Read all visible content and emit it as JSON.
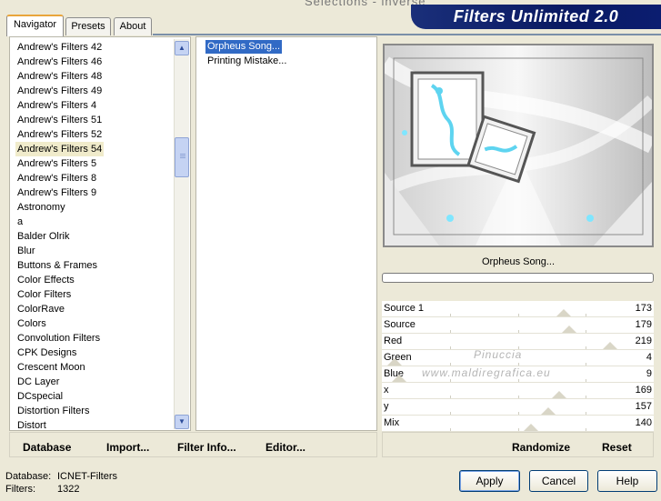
{
  "app": {
    "brand_title": "Filters Unlimited 2.0",
    "faint_title": "Selections - inverse"
  },
  "tabs": [
    {
      "label": "Navigator",
      "active": true
    },
    {
      "label": "Presets",
      "active": false
    },
    {
      "label": "About",
      "active": false
    }
  ],
  "categories": {
    "selected": "Andrew's Filters 54",
    "items": [
      "Andrew's Filters 42",
      "Andrew's Filters 46",
      "Andrew's Filters 48",
      "Andrew's Filters 49",
      "Andrew's Filters 4",
      "Andrew's Filters 51",
      "Andrew's Filters 52",
      "Andrew's Filters 54",
      "Andrew's Filters 5",
      "Andrew's Filters 8",
      "Andrew's Filters 9",
      "Astronomy",
      "a",
      "Balder Olrik",
      "Blur",
      "Buttons & Frames",
      "Color Effects",
      "Color Filters",
      "ColorRave",
      "Colors",
      "Convolution Filters",
      "CPK Designs",
      "Crescent Moon",
      "DC Layer",
      "DCspecial",
      "Distortion Filters",
      "Distort"
    ]
  },
  "filters": {
    "selected": "Orpheus Song...",
    "items": [
      "Orpheus Song...",
      "Printing Mistake..."
    ]
  },
  "preview": {
    "filter_name": "Orpheus Song...",
    "watermark_line1": "Pinuccia",
    "watermark_line2": "www.maldiregrafica.eu"
  },
  "params": [
    {
      "label": "Source 1",
      "value": "173",
      "level": 0.68
    },
    {
      "label": "Source",
      "value": "179",
      "level": 0.7
    },
    {
      "label": "Red",
      "value": "219",
      "level": 0.86
    },
    {
      "label": "Green",
      "value": "4",
      "level": 0.02
    },
    {
      "label": "Blue",
      "value": "9",
      "level": 0.04
    },
    {
      "label": "x",
      "value": "169",
      "level": 0.66
    },
    {
      "label": "y",
      "value": "157",
      "level": 0.62
    },
    {
      "label": "Mix",
      "value": "140",
      "level": 0.55
    }
  ],
  "left_buttons": {
    "database": "Database",
    "import": "Import...",
    "filter_info": "Filter Info...",
    "editor": "Editor..."
  },
  "right_buttons": {
    "randomize": "Randomize",
    "reset": "Reset"
  },
  "status": {
    "database_label": "Database:",
    "database_value": "ICNET-Filters",
    "filters_label": "Filters:",
    "filters_value": "1322"
  },
  "dialog_buttons": {
    "apply": "Apply",
    "cancel": "Cancel",
    "help": "Help"
  },
  "colors": {
    "brand_bg": "#0a1a63",
    "selection": "#316ac5",
    "selected_category_bg": "#f0ebcb"
  }
}
